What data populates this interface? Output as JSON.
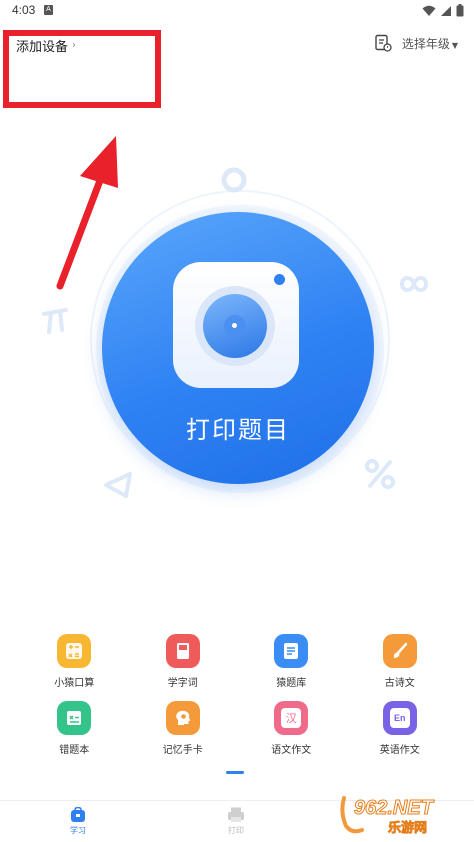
{
  "status_bar": {
    "time": "4:03",
    "badge": "A"
  },
  "header": {
    "add_device": "添加设备",
    "grade_select": "选择年级"
  },
  "main": {
    "print_label": "打印题目"
  },
  "features": [
    {
      "label": "小猿口算",
      "icon": "calculator-icon",
      "color": "#f7b733"
    },
    {
      "label": "学字词",
      "icon": "book-icon",
      "color": "#ef5b5b"
    },
    {
      "label": "猿题库",
      "icon": "document-icon",
      "color": "#3b8cf5"
    },
    {
      "label": "古诗文",
      "icon": "brush-icon",
      "color": "#f59a3a"
    },
    {
      "label": "错题本",
      "icon": "notebook-icon",
      "color": "#33c48a"
    },
    {
      "label": "记忆手卡",
      "icon": "head-icon",
      "color": "#f59a3a"
    },
    {
      "label": "语文作文",
      "icon": "chinese-char-icon",
      "color": "#f06b8a"
    },
    {
      "label": "英语作文",
      "icon": "english-icon",
      "color": "#7a62e6"
    }
  ],
  "feature_chars": {
    "chinese": "汉",
    "english": "En"
  },
  "bottom_nav": {
    "study": "学习",
    "print": "打印"
  },
  "watermark": {
    "brand": "962.NET",
    "sub": "乐游网"
  },
  "colors": {
    "accent": "#2f80f0",
    "annotation": "#e8212b"
  }
}
